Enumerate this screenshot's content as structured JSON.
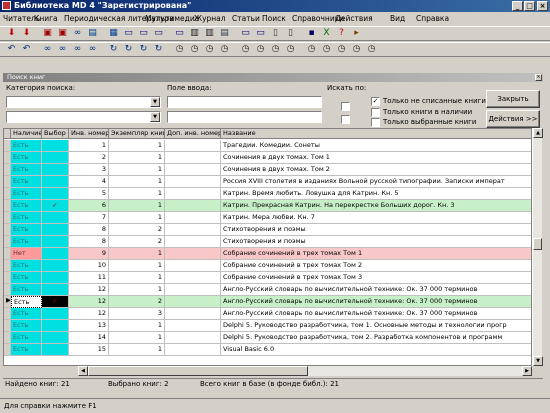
{
  "window": {
    "title": "Библиотека MD 4 \"Зарегистрирована\""
  },
  "window_controls": [
    "_",
    "□",
    "×"
  ],
  "menu": [
    "Читатель",
    "Книга",
    "Периодическая литература",
    "Мультимедиа",
    "Журнал",
    "Статьи",
    "Поиск",
    "Справочники",
    "Действия",
    "Вид",
    "Справка"
  ],
  "toolbar1_icons": [
    "reader-add-icon",
    "reader-edit-icon",
    "book-add-icon",
    "book-remove-icon",
    "binoculars-icon",
    "book-open-icon",
    "cards-icon",
    "window-icon",
    "window-icon",
    "monitor-icon",
    "monitor-icon",
    "print-icon",
    "print-icon",
    "book-icon",
    "window-icon",
    "window-icon",
    "document-icon",
    "document-icon",
    "save-icon",
    "excel-icon",
    "help-icon",
    "exit-icon"
  ],
  "toolbar2_icons": [
    "undo-icon",
    "undo-icon",
    "binoculars-icon",
    "binoculars-icon",
    "binoculars-icon",
    "binoculars-icon",
    "refresh-icon",
    "refresh-icon",
    "refresh-icon",
    "refresh-icon",
    "clock-icon",
    "clock-icon",
    "clock-icon",
    "clock-icon",
    "clock-icon",
    "clock-icon",
    "clock-icon",
    "clock-icon",
    "clock-icon",
    "clock-icon",
    "clock-icon",
    "clock-icon",
    "clock-icon"
  ],
  "search_panel": {
    "header": "Поиск книг",
    "category_label": "Категория поиска:",
    "field_label": "Поле ввода:",
    "search_in_label": "Искать по:",
    "checkboxes": [
      {
        "label": "Только не списанные книги",
        "checked": true
      },
      {
        "label": "Только книги в наличии",
        "checked": false
      },
      {
        "label": "Только выбранные книги",
        "checked": false
      }
    ],
    "close_button": "Закрыть",
    "actions_button": "Действия >>"
  },
  "colors": {
    "available": "#00e0e0",
    "on_hand": "#ff9a9a",
    "selected_row": "#c8f0c8",
    "missing_row": "#f8c8c8"
  },
  "table": {
    "columns": [
      "Наличие",
      "Выбор",
      "Инв. номер",
      "Экземпляр книги",
      "Доп. инв. номер",
      "Название"
    ],
    "rows": [
      {
        "status": "Есть",
        "select": "",
        "inv": "1",
        "copy": "1",
        "extra": "",
        "title": "Трагедии. Комедии. Сонеты",
        "hl": ""
      },
      {
        "status": "Есть",
        "select": "",
        "inv": "2",
        "copy": "1",
        "extra": "",
        "title": "Сочинения в двух томах. Том 1",
        "hl": ""
      },
      {
        "status": "Есть",
        "select": "",
        "inv": "3",
        "copy": "1",
        "extra": "",
        "title": "Сочинения в двух томах. Том 2",
        "hl": ""
      },
      {
        "status": "Есть",
        "select": "",
        "inv": "4",
        "copy": "1",
        "extra": "",
        "title": "Россия XVIII столетия в изданиях Вольной русской типографии. Записки императ",
        "hl": ""
      },
      {
        "status": "Есть",
        "select": "",
        "inv": "5",
        "copy": "1",
        "extra": "",
        "title": "Катрин. Время любить. Ловушка для Катрин. Кн. 5",
        "hl": ""
      },
      {
        "status": "Есть",
        "select": "✓",
        "inv": "6",
        "copy": "1",
        "extra": "",
        "title": "Катрин. Прекрасная Катрин. На перекрестке Больших дорог. Кн. 3",
        "hl": "green"
      },
      {
        "status": "Есть",
        "select": "",
        "inv": "7",
        "copy": "1",
        "extra": "",
        "title": "Катрин. Мера любви. Кн. 7",
        "hl": ""
      },
      {
        "status": "Есть",
        "select": "",
        "inv": "8",
        "copy": "2",
        "extra": "",
        "title": "Стихотворения и поэмы",
        "hl": ""
      },
      {
        "status": "Есть",
        "select": "",
        "inv": "8",
        "copy": "2",
        "extra": "",
        "title": "Стихотворения и поэмы",
        "hl": ""
      },
      {
        "status": "Нет",
        "select": "",
        "inv": "9",
        "copy": "1",
        "extra": "",
        "title": "Собрание сочинений в трех томах Том 1",
        "hl": "red"
      },
      {
        "status": "Есть",
        "select": "",
        "inv": "10",
        "copy": "1",
        "extra": "",
        "title": "Собрание сочинений в трех томах Том 2",
        "hl": ""
      },
      {
        "status": "Есть",
        "select": "",
        "inv": "11",
        "copy": "1",
        "extra": "",
        "title": "Собрание сочинений в трех томах Том 3",
        "hl": ""
      },
      {
        "status": "Есть",
        "select": "",
        "inv": "12",
        "copy": "1",
        "extra": "",
        "title": "Англо-Русский словарь по вычислительной технике: Ок. 37 000 терминов",
        "hl": ""
      },
      {
        "status": "Есть",
        "select": "✓",
        "inv": "12",
        "copy": "2",
        "extra": "",
        "title": "Англо-Русский словарь по вычислительной технике: Ок. 37 000 терминов",
        "hl": "green",
        "current": true
      },
      {
        "status": "Есть",
        "select": "",
        "inv": "12",
        "copy": "3",
        "extra": "",
        "title": "Англо-Русский словарь по вычислительной технике: Ок. 37 000 терминов",
        "hl": ""
      },
      {
        "status": "Есть",
        "select": "",
        "inv": "13",
        "copy": "1",
        "extra": "",
        "title": "Delphi 5. Руководство разработчика, том 1. Основные методы и технологии прогр",
        "hl": ""
      },
      {
        "status": "Есть",
        "select": "",
        "inv": "14",
        "copy": "1",
        "extra": "",
        "title": "Delphi 5. Руководство разработчика, том 2. Разработка компонентов и программ",
        "hl": ""
      },
      {
        "status": "Есть",
        "select": "",
        "inv": "15",
        "copy": "1",
        "extra": "",
        "title": "Visual Basic 6.0",
        "hl": ""
      }
    ]
  },
  "stats": {
    "found": "Найдено книг: 21",
    "selected": "Выбрано книг: 2",
    "total": "Всего книг в базе (в фонде библ.): 21"
  },
  "statusbar": "Для справки нажмите F1"
}
